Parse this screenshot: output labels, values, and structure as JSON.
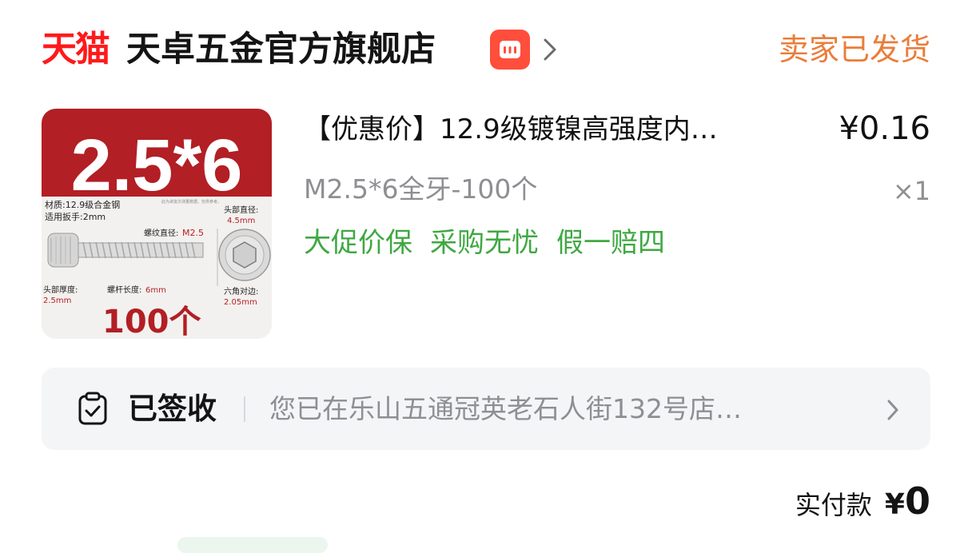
{
  "shop": {
    "platform_logo": "天猫",
    "name": "天卓五金官方旗舰店",
    "badge_icon": "shop-badge-icon",
    "badge_color": "#ff4e3b",
    "order_status": "卖家已发货",
    "status_color": "#ea7d3a"
  },
  "product": {
    "title": "【优惠价】12.9级镀镍高强度内…",
    "price": "¥0.16",
    "spec": "M2.5*6全牙-100个",
    "quantity": "×1",
    "service_tags": [
      "大促价保",
      "采购无忧",
      "假一赔四"
    ],
    "tag_color": "#3fa842",
    "image": {
      "size_text": "2.5*6",
      "material": "材质:12.9级合金钢",
      "wrench": "适用扳手:2mm",
      "thread_diameter_label": "螺纹直径:",
      "thread_diameter_value": "M2.5",
      "head_diameter_label": "头部直径:",
      "head_diameter_value": "4.5mm",
      "head_thickness_label": "头部厚度:",
      "head_thickness_value": "2.5mm",
      "shaft_length_label": "螺杆长度:",
      "shaft_length_value": "6mm",
      "hex_label": "六角对边:",
      "hex_value": "2.05mm",
      "count": "100个",
      "disclaimer": "此为卓批次测量数据，仅供参考。"
    }
  },
  "logistics": {
    "status": "已签收",
    "detail": "您已在乐山五通冠英老石人街132号店…",
    "icon": "clipboard-check-icon"
  },
  "payment": {
    "label": "实付款",
    "currency": "¥",
    "amount": "0"
  }
}
